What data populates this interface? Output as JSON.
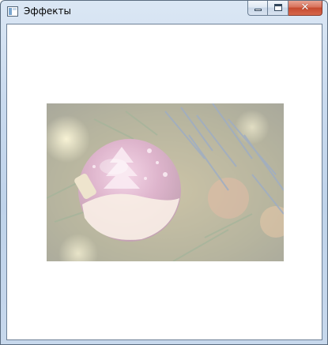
{
  "window": {
    "title": "Эффекты",
    "icons": {
      "app": "window-app-icon",
      "minimize": "minimize-icon",
      "maximize": "maximize-icon",
      "close": "close-icon"
    },
    "close_glyph": "✕"
  },
  "content": {
    "image": {
      "subject": "christmas-ornament-photo",
      "effect_opacity": 0.45
    }
  }
}
